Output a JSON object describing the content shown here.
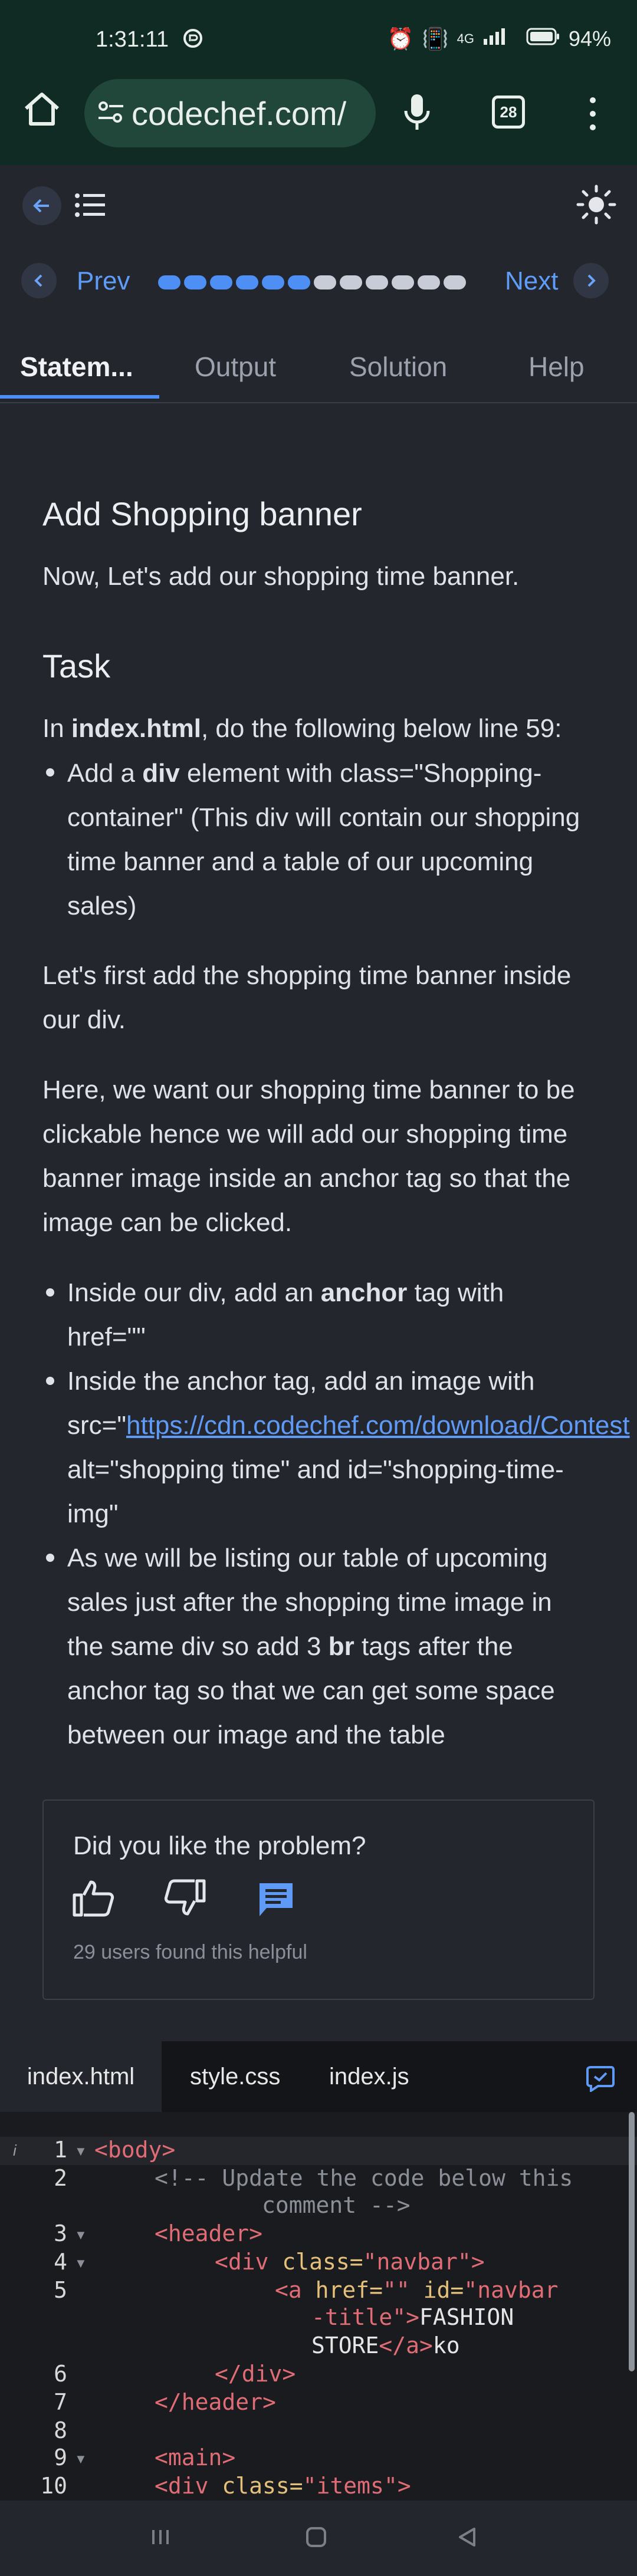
{
  "status_bar": {
    "time": "1:31:11",
    "battery": "94%",
    "network": "4G"
  },
  "browser": {
    "url": "codechef.com/",
    "tab_count": "28"
  },
  "toolbar": {
    "prev_label": "Prev",
    "next_label": "Next",
    "progress_total": 12,
    "progress_done": 6
  },
  "tabs": [
    {
      "label": "Statem..."
    },
    {
      "label": "Output"
    },
    {
      "label": "Solution"
    },
    {
      "label": "Help"
    }
  ],
  "content": {
    "title": "Add Shopping banner",
    "intro": "Now, Let's add our shopping time banner.",
    "task_heading": "Task",
    "task_intro_pre": "In ",
    "task_intro_file": "index.html",
    "task_intro_post": ", do the following below line 59:",
    "bullet1_pre": "Add a ",
    "bullet1_bold": "div",
    "bullet1_line1_post": " element with class=\"Shopping-",
    "bullet1_line2": "container\" (This div will contain our shopping",
    "bullet1_line3": "time banner and a table of our upcoming",
    "bullet1_line4": "sales)",
    "para2_line1": "Let's first add the shopping time banner inside",
    "para2_line2": "our div.",
    "para3_line1": "Here, we want our shopping time banner to be",
    "para3_line2": "clickable hence we will add our shopping time",
    "para3_line3": "banner image inside an anchor tag so that the",
    "para3_line4": "image can be clicked.",
    "b2_pre": "Inside our div, add an ",
    "b2_bold": "anchor",
    "b2_post": " tag with",
    "b2_line2": "href=\"\"",
    "b3_line1": "Inside the anchor tag, add an image with",
    "b3_src_pre": "src=\"",
    "b3_link": "https://cdn.codechef.com/download/Contest",
    "b3_line3": "alt=\"shopping time\" and id=\"shopping-time-",
    "b3_line4": "img\"",
    "b4_line1": "As we will be listing our table of upcoming",
    "b4_line2": "sales just after the shopping time image in",
    "b4_line3_pre": "the same div so add 3 ",
    "b4_line3_bold": "br",
    "b4_line3_post": " tags after the",
    "b4_line4": "anchor tag so that we can get some space",
    "b4_line5": "between our image and the table"
  },
  "feedback": {
    "question": "Did you like the problem?",
    "helpful_count": "29 users found this helpful"
  },
  "editor": {
    "files": [
      "index.html",
      "style.css",
      "index.js"
    ],
    "active_file": "index.html",
    "line_numbers": [
      "1",
      "2",
      "3",
      "4",
      "5",
      "6",
      "7",
      "8",
      "9",
      "10"
    ],
    "lines": {
      "l1": "<body>",
      "l2a": "<!-- Update the code below this",
      "l2b": "comment -->",
      "l3": "<header>",
      "l4_tag": "<div ",
      "l4_attr": "class=",
      "l4_str": "\"navbar\"",
      "l4_end": ">",
      "l5_tag": "<a ",
      "l5_attr": "href=",
      "l5_str": "\"\"",
      "l5_attr2": " id=",
      "l5_str2": "\"navbar",
      "l5b_str": "-title\"",
      "l5b_end": ">",
      "l5b_txt": "FASHION",
      "l5c_txt": "STORE",
      "l5c_tag": "</a>",
      "l5c_tail": "ko",
      "l6": "</div>",
      "l7": "</header>",
      "l9": "<main>",
      "l10_tag": "<div ",
      "l10_attr": "class=",
      "l10_str": "\"items\">"
    }
  },
  "colors": {
    "accent": "#4d8ff5",
    "background": "#24262e",
    "status_bar": "#0f2b23",
    "url_bar": "#21463a"
  }
}
